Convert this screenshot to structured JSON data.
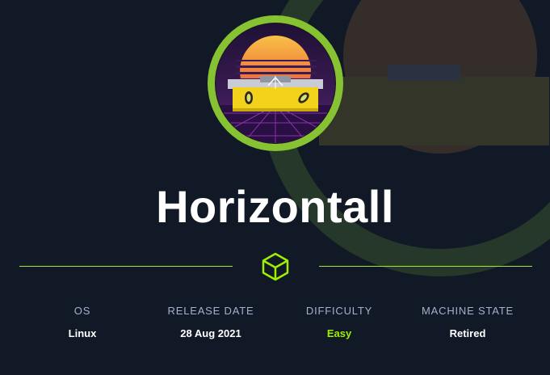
{
  "machine": {
    "name": "Horizontall"
  },
  "stats": [
    {
      "label": "OS",
      "value": "Linux"
    },
    {
      "label": "RELEASE DATE",
      "value": "28 Aug 2021"
    },
    {
      "label": "DIFFICULTY",
      "value": "Easy"
    },
    {
      "label": "MACHINE STATE",
      "value": "Retired"
    }
  ],
  "colors": {
    "background": "#111927",
    "accent": "#9fef00",
    "avatar_ring": "#86c232",
    "label": "#a4b1cd",
    "value": "#ffffff"
  },
  "icons": {
    "divider_icon": "cube-icon"
  }
}
